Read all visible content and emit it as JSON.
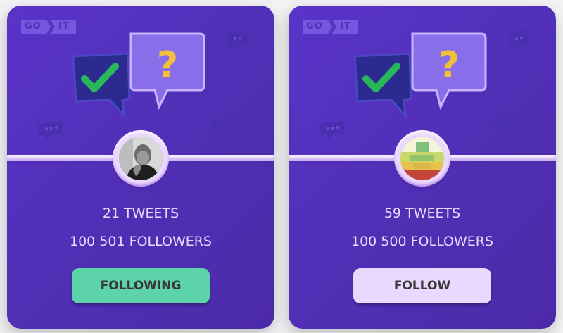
{
  "cards": [
    {
      "logo": {
        "left": "GO",
        "right": "IT"
      },
      "avatar": "user-photo-1",
      "tweets": "21 TWEETS",
      "followers": "100 501 FOLLOWERS",
      "button_label": "FOLLOWING",
      "button_color": "#5cd3a8"
    },
    {
      "logo": {
        "left": "GO",
        "right": "IT"
      },
      "avatar": "user-photo-2",
      "tweets": "59 TWEETS",
      "followers": "100 500 FOLLOWERS",
      "button_label": "FOLLOW",
      "button_color": "#ebd8ff"
    }
  ],
  "colors": {
    "card_background": "#5736cc",
    "text": "#ebd8ff",
    "following_button": "#5cd3a8",
    "follow_button": "#ebd8ff"
  },
  "icons": [
    "goit-logo",
    "checkmark-bubble-icon",
    "question-bubble-icon",
    "chat-bubble-icon",
    "heart-icon",
    "avatar"
  ]
}
